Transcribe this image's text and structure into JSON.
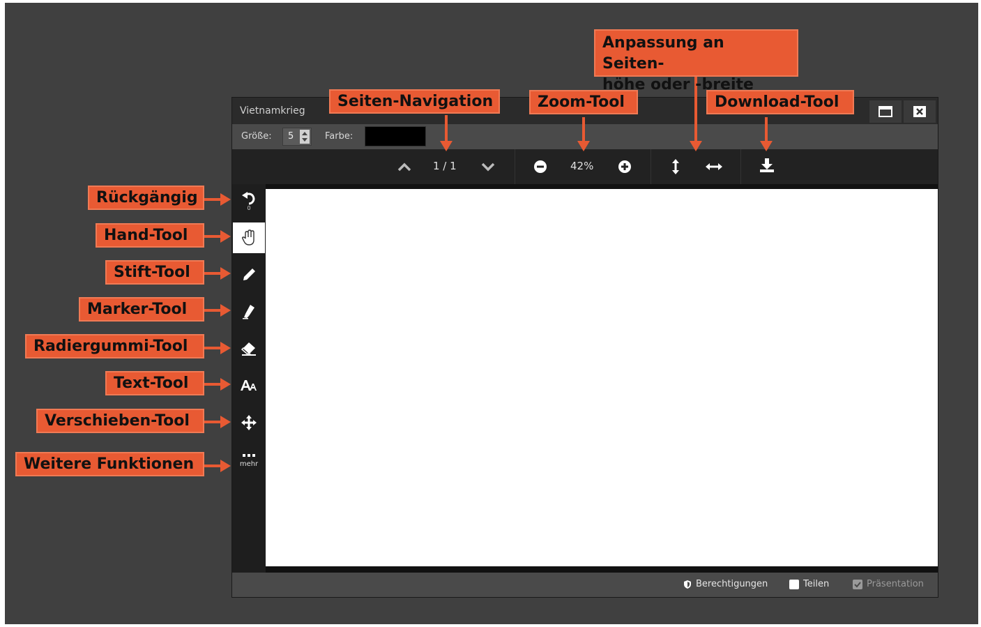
{
  "window": {
    "title": "Vietnamkrieg",
    "maximize_icon": "maximize-icon",
    "close_icon": "close-icon"
  },
  "options": {
    "size_label": "Größe:",
    "size_value": "5",
    "color_label": "Farbe:",
    "color_value": "#000000"
  },
  "nav": {
    "page_indicator": "1 / 1",
    "zoom_value": "42%"
  },
  "sidebar": {
    "undo_count": "0",
    "more_label": "mehr"
  },
  "status": {
    "permissions": "Berechtigungen",
    "share": "Teilen",
    "presentation": "Präsentation"
  },
  "callouts": {
    "undo": "Rückgängig",
    "hand": "Hand-Tool",
    "pen": "Stift-Tool",
    "marker": "Marker-Tool",
    "eraser": "Radiergummi-Tool",
    "text": "Text-Tool",
    "move": "Verschieben-Tool",
    "more": "Weitere Funktionen",
    "page_nav": "Seiten-Navigation",
    "zoom": "Zoom-Tool",
    "fit": "Anpassung an Seiten-\nhöhe oder -breite",
    "download": "Download-Tool"
  },
  "colors": {
    "callout": "#e85a33",
    "backdrop": "#404040",
    "canvas": "#ffffff"
  }
}
